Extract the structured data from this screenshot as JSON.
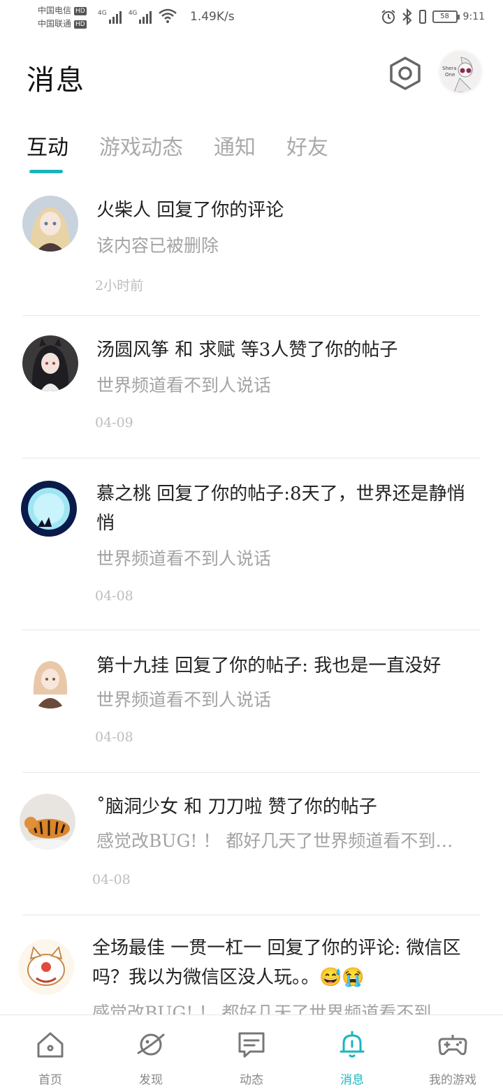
{
  "status_bar": {
    "carrier1": "中国电信",
    "carrier2": "中国联通",
    "hd": "HD",
    "net1": "4G",
    "net2": "4G",
    "speed": "1.49K/s",
    "battery": "58",
    "time": "9:11"
  },
  "header": {
    "title": "消息",
    "avatar_text": "Shera One"
  },
  "tabs": [
    {
      "label": "互动"
    },
    {
      "label": "游戏动态"
    },
    {
      "label": "通知"
    },
    {
      "label": "好友"
    }
  ],
  "messages": [
    {
      "title": "火柴人 回复了你的评论",
      "sub": "该内容已被删除",
      "time": "2小时前"
    },
    {
      "title": "汤圆风筝 和 求赋 等3人赞了你的帖子",
      "sub": "世界频道看不到人说话",
      "time": "04-09"
    },
    {
      "title": "慕之桃 回复了你的帖子:8天了，世界还是静悄悄",
      "sub": "世界频道看不到人说话",
      "time": "04-08"
    },
    {
      "title": "第十九挂 回复了你的帖子: 我也是一直没好",
      "sub": "世界频道看不到人说话",
      "time": "04-08"
    },
    {
      "title": "˚脑洞少女 和 刀刀啦 赞了你的帖子",
      "sub": "感觉改BUG! ！ 都好几天了世界频道看不到…",
      "time": "04-08"
    },
    {
      "title": "全场最佳 一贯一杠一 回复了你的评论: 微信区吗？我以为微信区没人玩。。😅😭",
      "sub": "感觉改BUG! ！ 都好几天了世界频道看不到…",
      "time": ""
    }
  ],
  "nav": [
    {
      "label": "首页"
    },
    {
      "label": "发现"
    },
    {
      "label": "动态"
    },
    {
      "label": "消息"
    },
    {
      "label": "我的游戏"
    }
  ],
  "colors": {
    "accent": "#1bb4c0",
    "muted": "#a3a3a3"
  }
}
